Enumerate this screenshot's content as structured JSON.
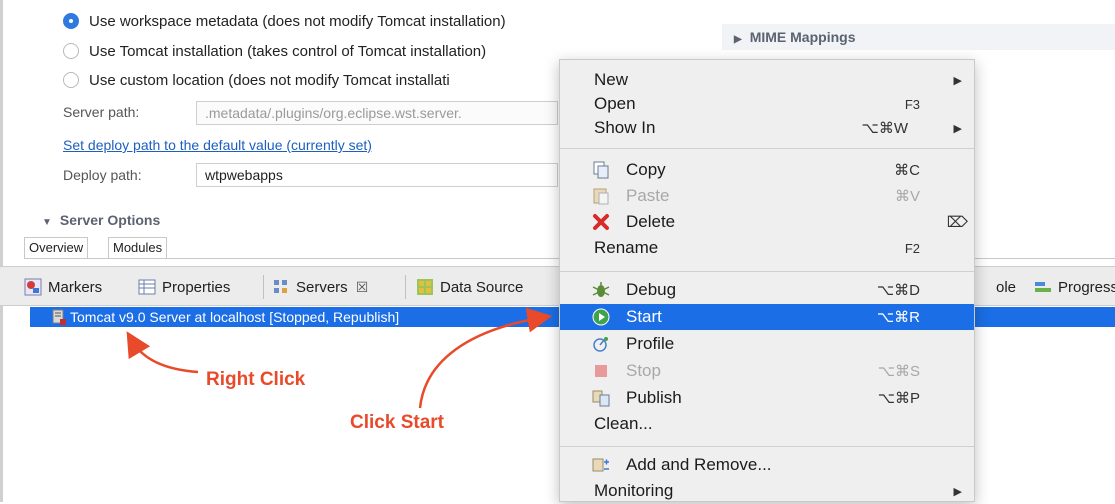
{
  "editor": {
    "radio_options": [
      {
        "label": "Use workspace metadata (does not modify Tomcat installation)",
        "selected": true
      },
      {
        "label": "Use Tomcat installation (takes control of Tomcat installation)",
        "selected": false
      },
      {
        "label": "Use custom location (does not modify Tomcat installati",
        "selected": false
      }
    ],
    "server_path_label": "Server path:",
    "server_path_value": ".metadata/.plugins/org.eclipse.wst.server.",
    "deploy_link": "Set deploy path to the default value (currently set)",
    "deploy_path_label": "Deploy path:",
    "deploy_path_value": "wtpwebapps",
    "server_options_section": "Server Options",
    "mime_section": "MIME Mappings",
    "tabs": {
      "overview": "Overview",
      "modules": "Modules"
    }
  },
  "views": {
    "tabs": [
      "Markers",
      "Properties",
      "Servers",
      "Data Source",
      "ole",
      "Progress"
    ],
    "servers_close": "☒",
    "server_row": "Tomcat v9.0 Server at localhost  [Stopped, Republish]"
  },
  "annotations": {
    "right_click": "Right Click",
    "click_start": "Click Start"
  },
  "context_menu": {
    "items": [
      {
        "label": "New",
        "shortcut": "",
        "submenu": true
      },
      {
        "label": "Open",
        "shortcut": "F3",
        "submenu": false
      },
      {
        "label": "Show In",
        "shortcut": "⌥⌘W",
        "submenu": true
      },
      {
        "label": "Copy",
        "shortcut": "⌘C",
        "icon": "copy-icon"
      },
      {
        "label": "Paste",
        "shortcut": "⌘V",
        "icon": "paste-icon",
        "disabled": true
      },
      {
        "label": "Delete",
        "shortcut": "⌦",
        "icon": "delete-icon"
      },
      {
        "label": "Rename",
        "shortcut": "F2"
      },
      {
        "label": "Debug",
        "shortcut": "⌥⌘D",
        "icon": "debug-icon"
      },
      {
        "label": "Start",
        "shortcut": "⌥⌘R",
        "icon": "start-icon",
        "highlighted": true
      },
      {
        "label": "Profile",
        "shortcut": "",
        "icon": "profile-icon"
      },
      {
        "label": "Stop",
        "shortcut": "⌥⌘S",
        "icon": "stop-icon",
        "disabled": true
      },
      {
        "label": "Publish",
        "shortcut": "⌥⌘P",
        "icon": "publish-icon"
      },
      {
        "label": "Clean...",
        "shortcut": ""
      },
      {
        "label": "Add and Remove...",
        "shortcut": "",
        "icon": "add-remove-icon"
      },
      {
        "label": "Monitoring",
        "shortcut": "",
        "submenu": true
      }
    ],
    "submenu_arrow": "▶"
  },
  "colors": {
    "selection_blue": "#1b6ee6",
    "annotation_red": "#e84a2a",
    "menu_bg": "#efefef"
  }
}
